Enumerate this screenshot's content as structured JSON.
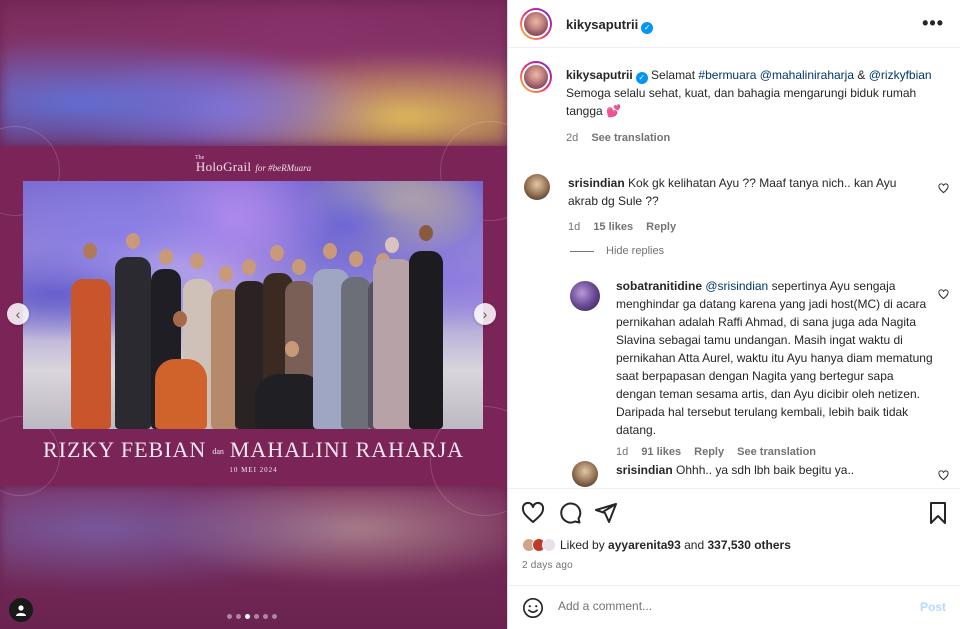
{
  "media": {
    "brand_the": "The",
    "brand_name": "HoloGrail",
    "brand_for": "for #beRMuara",
    "groom": "RIZKY FEBIAN",
    "dan": "dan",
    "bride": "MAHALINI RAHARJA",
    "date": "10 MEI 2024",
    "nav_left": "‹",
    "nav_right": "›",
    "carousel_total": 6,
    "carousel_active": 3
  },
  "header": {
    "username": "kikysaputrii",
    "more": "•••"
  },
  "caption": {
    "username": "kikysaputrii",
    "text1": "Selamat",
    "hashtag": "#bermuara",
    "mention1": "@mahaliniraharja",
    "amp": "&",
    "mention2": "@rizkyfbian",
    "text2": "Semoga selalu sehat, kuat, dan bahagia mengarungi biduk rumah tangga 💕",
    "time": "2d",
    "see_translation": "See translation"
  },
  "comments": [
    {
      "username": "srisindian",
      "text": "Kok gk kelihatan Ayu ?? Maaf tanya nich.. kan Ayu akrab dg Sule ??",
      "time": "1d",
      "likes": "15 likes",
      "reply": "Reply"
    }
  ],
  "hide_replies": "Hide replies",
  "reply": {
    "username": "sobatranitidine",
    "mention": "@srisindian",
    "text": "sepertinya Ayu sengaja menghindar ga datang karena yang jadi host(MC) di acara pernikahan adalah Raffi Ahmad, di sana juga ada Nagita Slavina sebagai tamu undangan. Masih ingat waktu di pernikahan Atta Aurel, waktu itu Ayu hanya diam mematung saat berpapasan dengan Nagita yang bertegur sapa dengan teman sesama artis, dan Ayu dicibir oleh netizen. Daripada hal tersebut terulang kembali, lebih baik tidak datang.",
    "time": "1d",
    "likes": "91 likes",
    "reply_label": "Reply",
    "see_translation": "See translation"
  },
  "reply2": {
    "username": "srisindian",
    "text": "Ohhh.. ya sdh lbh baik begitu ya.."
  },
  "likes": {
    "liked_by": "Liked by",
    "user": "ayyarenita93",
    "and": "and",
    "others": "337,530 others"
  },
  "time_ago": "2 days ago",
  "add_comment": {
    "placeholder": "Add a comment...",
    "post": "Post"
  },
  "colors": {
    "verified": "#0095f6",
    "link": "#00376b",
    "muted": "#737373",
    "media_bg": "#7b2458"
  }
}
